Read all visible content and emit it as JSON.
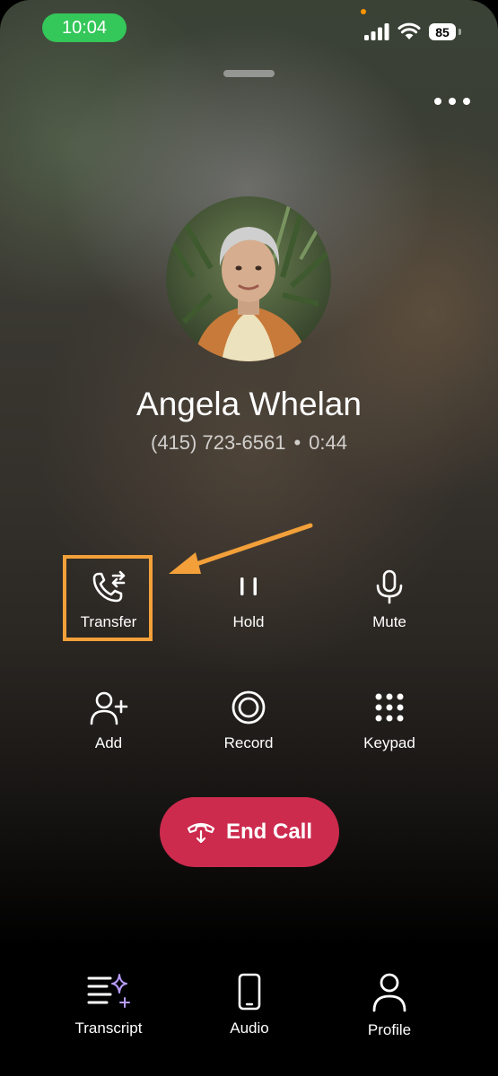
{
  "status_bar": {
    "time": "10:04",
    "battery": "85"
  },
  "caller": {
    "name": "Angela Whelan",
    "number": "(415) 723-6561",
    "duration": "0:44",
    "separator": "•"
  },
  "actions": [
    {
      "label": "Transfer",
      "icon": "phone-transfer-icon"
    },
    {
      "label": "Hold",
      "icon": "pause-icon"
    },
    {
      "label": "Mute",
      "icon": "microphone-icon"
    },
    {
      "label": "Add",
      "icon": "add-person-icon"
    },
    {
      "label": "Record",
      "icon": "record-icon"
    },
    {
      "label": "Keypad",
      "icon": "keypad-icon"
    }
  ],
  "end_call": {
    "label": "End Call",
    "color": "#cc2b4e"
  },
  "tabs": [
    {
      "label": "Transcript",
      "icon": "transcript-sparkle-icon"
    },
    {
      "label": "Audio",
      "icon": "phone-device-icon"
    },
    {
      "label": "Profile",
      "icon": "person-icon"
    }
  ],
  "colors": {
    "time_pill": "#34c759",
    "highlight": "#f3a03a",
    "end_call": "#cc2b4e"
  }
}
